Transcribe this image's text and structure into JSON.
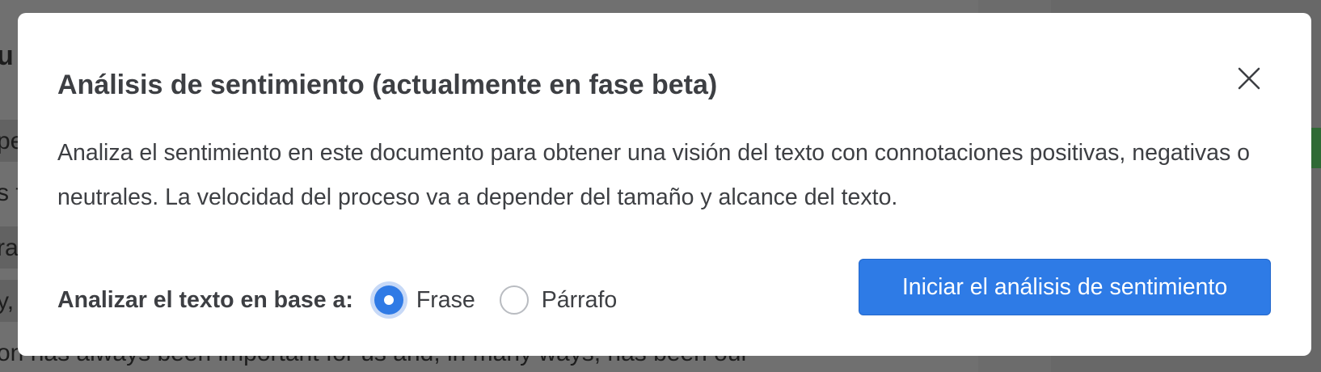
{
  "background": {
    "doc_fragments": [
      "u",
      "pe",
      "s f",
      "ra",
      "y,",
      "on has always been important for us and, in many ways, has been our"
    ]
  },
  "modal": {
    "title": "Análisis de sentimiento (actualmente en fase beta)",
    "close_icon": "close-icon",
    "description": "Analiza el sentimiento en este documento para obtener una visión del texto con connotaciones positivas, negativas o neutrales. La velocidad del proceso va a depender del tamaño y alcance del texto.",
    "analyze_label": "Analizar el texto en base a:",
    "options": [
      {
        "label": "Frase",
        "selected": true
      },
      {
        "label": "Párrafo",
        "selected": false
      }
    ],
    "start_button": "Iniciar el análisis de sentimiento"
  },
  "colors": {
    "accent": "#2e7be6",
    "text": "#3d3f43",
    "overlay": "#6b6b6b"
  }
}
